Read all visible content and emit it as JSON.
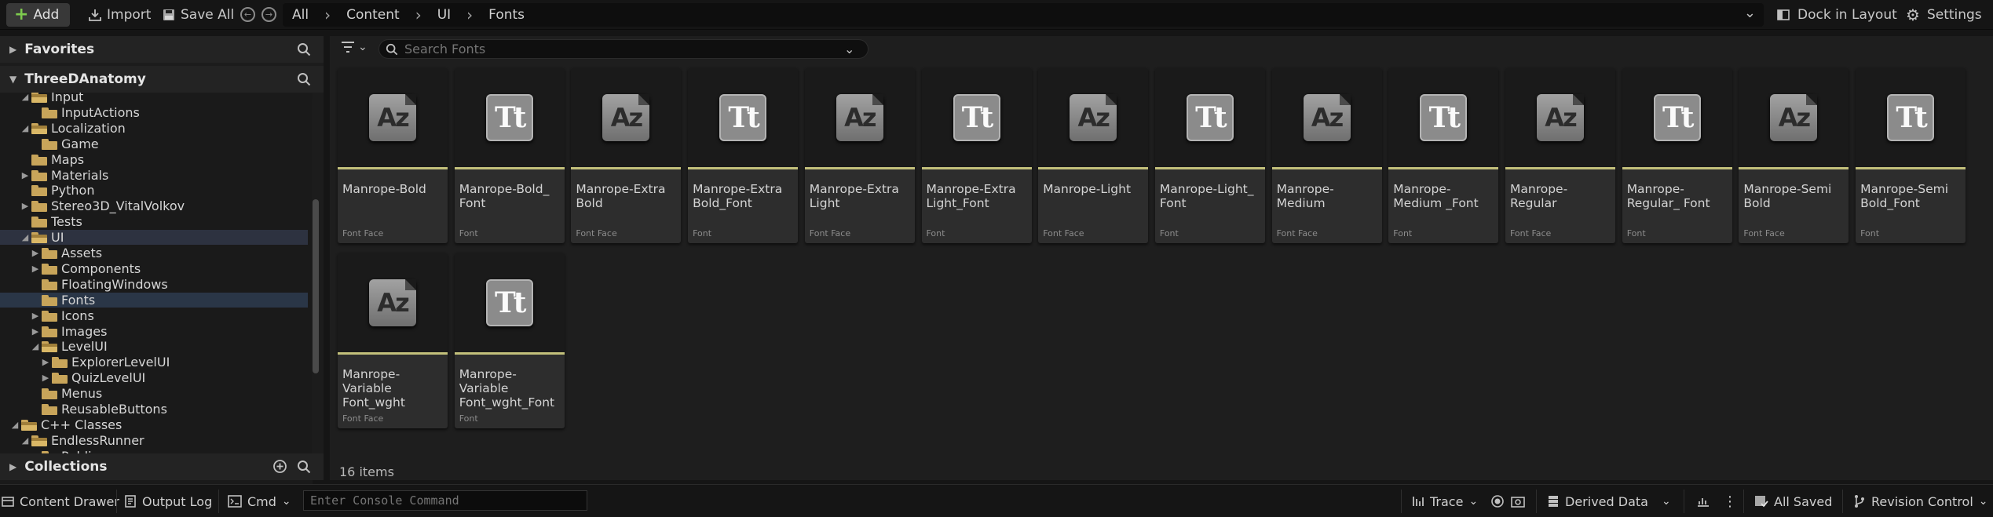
{
  "toolbar": {
    "add_label": "Add",
    "import_label": "Import",
    "save_all_label": "Save All",
    "breadcrumb": [
      "All",
      "Content",
      "UI",
      "Fonts"
    ],
    "dock_label": "Dock in Layout",
    "settings_label": "Settings"
  },
  "left_panel": {
    "favorites_label": "Favorites",
    "project_label": "ThreeDAnatomy",
    "tree": [
      {
        "label": "Input",
        "indent": 2,
        "arrow": "open",
        "open": true
      },
      {
        "label": "InputActions",
        "indent": 3,
        "arrow": "",
        "open": false
      },
      {
        "label": "Localization",
        "indent": 2,
        "arrow": "open",
        "open": true
      },
      {
        "label": "Game",
        "indent": 3,
        "arrow": "",
        "open": false
      },
      {
        "label": "Maps",
        "indent": 2,
        "arrow": "",
        "open": false
      },
      {
        "label": "Materials",
        "indent": 2,
        "arrow": "closed",
        "open": false
      },
      {
        "label": "Python",
        "indent": 2,
        "arrow": "",
        "open": false
      },
      {
        "label": "Stereo3D_VitalVolkov",
        "indent": 2,
        "arrow": "closed",
        "open": false
      },
      {
        "label": "Tests",
        "indent": 2,
        "arrow": "",
        "open": false
      },
      {
        "label": "UI",
        "indent": 2,
        "arrow": "open",
        "open": true
      },
      {
        "label": "Assets",
        "indent": 3,
        "arrow": "closed",
        "open": false
      },
      {
        "label": "Components",
        "indent": 3,
        "arrow": "closed",
        "open": false
      },
      {
        "label": "FloatingWindows",
        "indent": 3,
        "arrow": "",
        "open": false
      },
      {
        "label": "Fonts",
        "indent": 3,
        "arrow": "",
        "open": false
      },
      {
        "label": "Icons",
        "indent": 3,
        "arrow": "closed",
        "open": false
      },
      {
        "label": "Images",
        "indent": 3,
        "arrow": "closed",
        "open": false
      },
      {
        "label": "LevelUI",
        "indent": 3,
        "arrow": "open",
        "open": true
      },
      {
        "label": "ExplorerLevelUI",
        "indent": 4,
        "arrow": "closed",
        "open": false
      },
      {
        "label": "QuizLevelUI",
        "indent": 4,
        "arrow": "closed",
        "open": false
      },
      {
        "label": "Menus",
        "indent": 3,
        "arrow": "",
        "open": false
      },
      {
        "label": "ReusableButtons",
        "indent": 3,
        "arrow": "",
        "open": false
      },
      {
        "label": "C++ Classes",
        "indent": 1,
        "arrow": "open",
        "open": true
      },
      {
        "label": "EndlessRunner",
        "indent": 2,
        "arrow": "open",
        "open": true
      },
      {
        "label": "Public",
        "indent": 3,
        "arrow": "",
        "open": false
      }
    ],
    "selected_item": "UI",
    "current_item": "Fonts",
    "collections_label": "Collections"
  },
  "content": {
    "search_placeholder": "Search Fonts",
    "items": [
      {
        "name": "Manrope-Bold",
        "type": "Font Face",
        "kind": "face"
      },
      {
        "name": "Manrope-Bold_ Font",
        "type": "Font",
        "kind": "font"
      },
      {
        "name": "Manrope-Extra Bold",
        "type": "Font Face",
        "kind": "face"
      },
      {
        "name": "Manrope-Extra Bold_Font",
        "type": "Font",
        "kind": "font"
      },
      {
        "name": "Manrope-Extra Light",
        "type": "Font Face",
        "kind": "face"
      },
      {
        "name": "Manrope-Extra Light_Font",
        "type": "Font",
        "kind": "font"
      },
      {
        "name": "Manrope-Light",
        "type": "Font Face",
        "kind": "face"
      },
      {
        "name": "Manrope-Light_ Font",
        "type": "Font",
        "kind": "font"
      },
      {
        "name": "Manrope-Medium",
        "type": "Font Face",
        "kind": "face"
      },
      {
        "name": "Manrope-Medium _Font",
        "type": "Font",
        "kind": "font"
      },
      {
        "name": "Manrope-Regular",
        "type": "Font Face",
        "kind": "face"
      },
      {
        "name": "Manrope-Regular_ Font",
        "type": "Font",
        "kind": "font"
      },
      {
        "name": "Manrope-Semi Bold",
        "type": "Font Face",
        "kind": "face"
      },
      {
        "name": "Manrope-Semi Bold_Font",
        "type": "Font",
        "kind": "font"
      },
      {
        "name": "Manrope-Variable Font_wght",
        "type": "Font Face",
        "kind": "face"
      },
      {
        "name": "Manrope-Variable Font_wght_Font",
        "type": "Font",
        "kind": "font"
      }
    ],
    "glyph_face": "Az",
    "glyph_font": "Tt",
    "items_count": "16 items"
  },
  "statusbar": {
    "content_drawer_label": "Content Drawer",
    "output_log_label": "Output Log",
    "cmd_label": "Cmd",
    "console_placeholder": "Enter Console Command",
    "trace_label": "Trace",
    "derived_data_label": "Derived Data",
    "all_saved_label": "All Saved",
    "revision_control_label": "Revision Control"
  },
  "colors": {
    "accent_underline": "#c3c07b",
    "folder": "#c8a55a",
    "add_plus": "#7ecb4e",
    "selection": "#2d3240"
  }
}
